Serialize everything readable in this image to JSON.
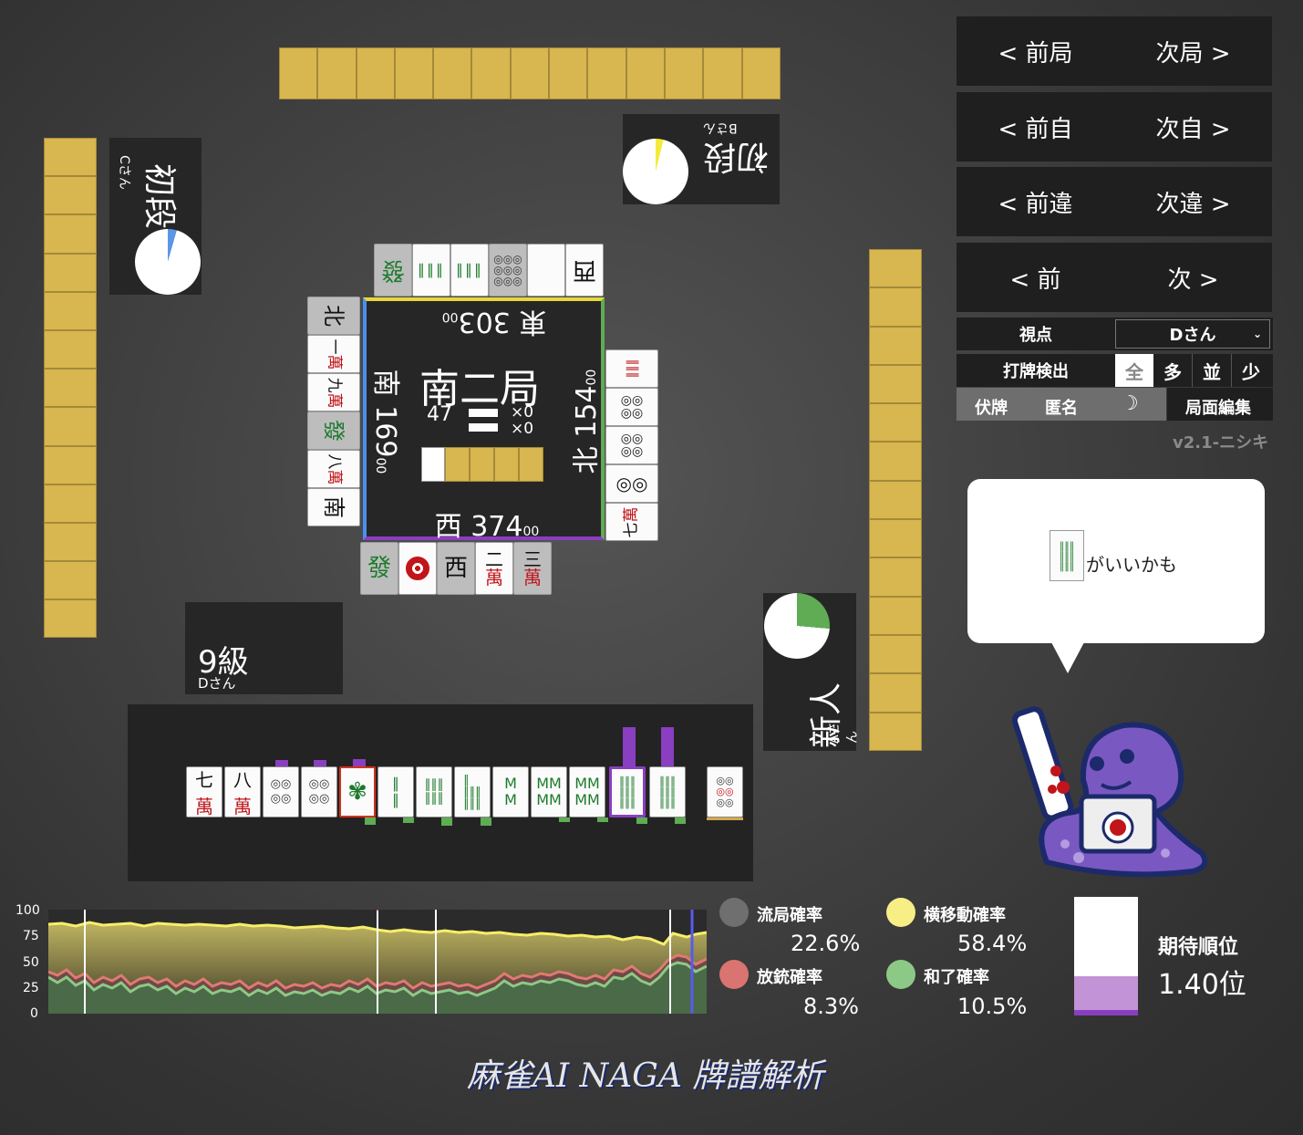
{
  "players": {
    "top": {
      "rank": "初段",
      "name": "Bさん"
    },
    "left": {
      "rank": "初段",
      "name": "Cさん"
    },
    "right": {
      "rank": "新人",
      "name": "Aさん"
    },
    "bottom": {
      "rank": "9級",
      "name": "Dさん"
    }
  },
  "center": {
    "round": "南二局",
    "honba_count": "47",
    "counter1": "×0",
    "counter2": "×0",
    "scores": {
      "top": {
        "wind": "東",
        "score": "303",
        "sub": "00"
      },
      "left": {
        "wind": "南",
        "score": "169",
        "sub": "00"
      },
      "right": {
        "wind": "北",
        "score": "154",
        "sub": "00"
      },
      "bottom": {
        "wind": "西",
        "score": "374",
        "sub": "00"
      }
    }
  },
  "discards": {
    "top": [
      "發",
      "索",
      "索",
      "筒",
      "白",
      "西"
    ],
    "left": [
      "北",
      "一萬",
      "九萬",
      "發",
      "八萬",
      "南"
    ],
    "right": [
      "索",
      "筒",
      "筒",
      "筒",
      "七萬"
    ],
    "bottom": [
      "發",
      "筒",
      "西",
      "二萬",
      "三萬"
    ]
  },
  "hand": {
    "tiles": [
      "七萬",
      "八萬",
      "筒",
      "筒",
      "索",
      "索",
      "索",
      "索",
      "索",
      "索",
      "索",
      "索",
      "索"
    ],
    "drawn": "筒"
  },
  "nav": {
    "prev_round": "< 前局",
    "next_round": "次局 >",
    "prev_self": "< 前自",
    "next_self": "次自 >",
    "prev_diff": "< 前違",
    "next_diff": "次違 >",
    "prev": "< 前",
    "next": "次 >"
  },
  "controls": {
    "viewpoint_label": "視点",
    "viewpoint_value": "Dさん",
    "detect_label": "打牌検出",
    "detect_options": [
      "全",
      "多",
      "並",
      "少"
    ],
    "hide_tiles": "伏牌",
    "anonymous": "匿名",
    "edit": "局面編集",
    "version": "v2.1-ニシキ",
    "night_icon": "moon-icon"
  },
  "advice": {
    "text": "がいいかも"
  },
  "stats": {
    "draw_label": "流局確率",
    "draw_value": "22.6%",
    "lateral_label": "横移動確率",
    "lateral_value": "58.4%",
    "dealin_label": "放銃確率",
    "dealin_value": "8.3%",
    "win_label": "和了確率",
    "win_value": "10.5%",
    "rank_label": "期待順位",
    "rank_value": "1.40位",
    "colors": {
      "draw": "#6f6f6f",
      "lateral": "#f7ee85",
      "dealin": "#d97470",
      "win": "#8dc986"
    }
  },
  "graph_axis": [
    "100",
    "75",
    "50",
    "25",
    "0"
  ],
  "footer": {
    "title": "麻雀AI NAGA 牌譜解析"
  }
}
